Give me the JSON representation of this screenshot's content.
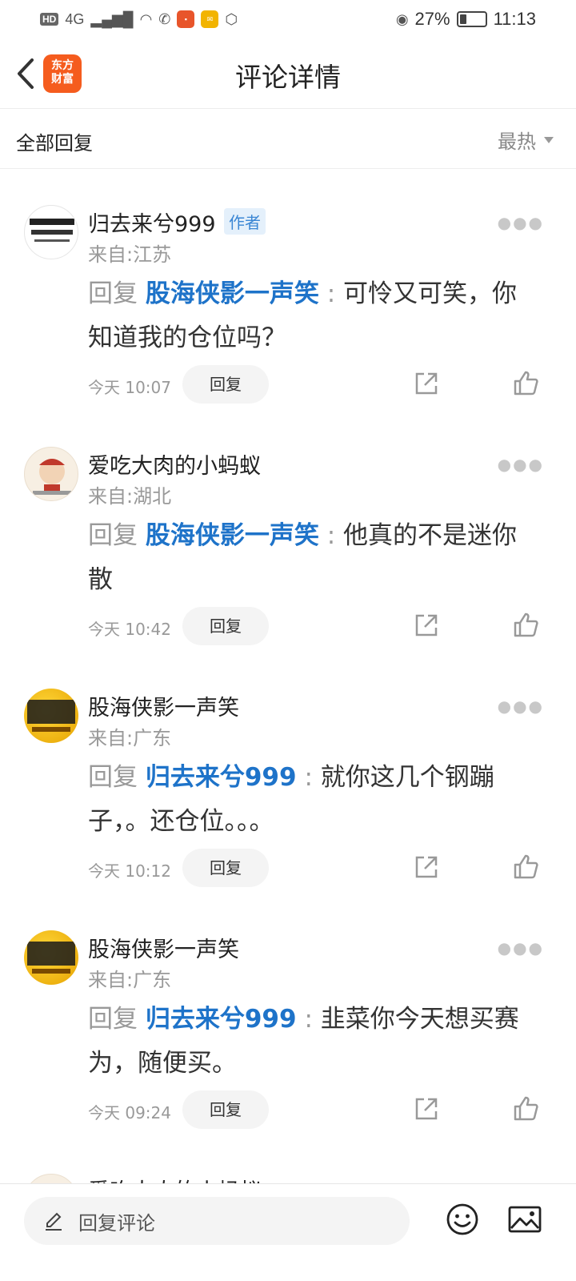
{
  "status_bar": {
    "network": "4G",
    "hd": "HD",
    "battery_percent": "27%",
    "battery_level": 0.27,
    "time": "11:13"
  },
  "header": {
    "title": "评论详情",
    "logo_line1": "东方",
    "logo_line2": "财富"
  },
  "filter": {
    "label": "全部回复",
    "sort": "最热"
  },
  "comments": [
    {
      "name": "归去来兮999",
      "badge": "作者",
      "location": "来自:江苏",
      "reply_prefix": "回复",
      "reply_target": "股海侠影一声笑",
      "colon": ":",
      "text": " 可怜又可笑，你知道我的仓位吗？",
      "time": "今天 10:07",
      "reply_label": "回复"
    },
    {
      "name": "爱吃大肉的小蚂蚁",
      "location": "来自:湖北",
      "reply_prefix": "回复",
      "reply_target": "股海侠影一声笑",
      "colon": ":",
      "text": " 他真的不是迷你散",
      "time": "今天 10:42",
      "reply_label": "回复"
    },
    {
      "name": "股海侠影一声笑",
      "location": "来自:广东",
      "reply_prefix": "回复",
      "reply_target": "归去来兮999",
      "colon": ":",
      "text": " 就你这几个钢蹦子，。还仓位。。。",
      "time": "今天 10:12",
      "reply_label": "回复"
    },
    {
      "name": "股海侠影一声笑",
      "location": "来自:广东",
      "reply_prefix": "回复",
      "reply_target": "归去来兮999",
      "colon": ":",
      "text": " 韭菜你今天想买赛为，随便买。",
      "time": "今天 09:24",
      "reply_label": "回复"
    }
  ],
  "partial_comment": {
    "name": "爱吃大肉的小蚂蚁"
  },
  "bottom_bar": {
    "placeholder": "回复评论"
  },
  "colors": {
    "accent_blue": "#1e73c9",
    "brand_orange": "#f55c1e"
  }
}
